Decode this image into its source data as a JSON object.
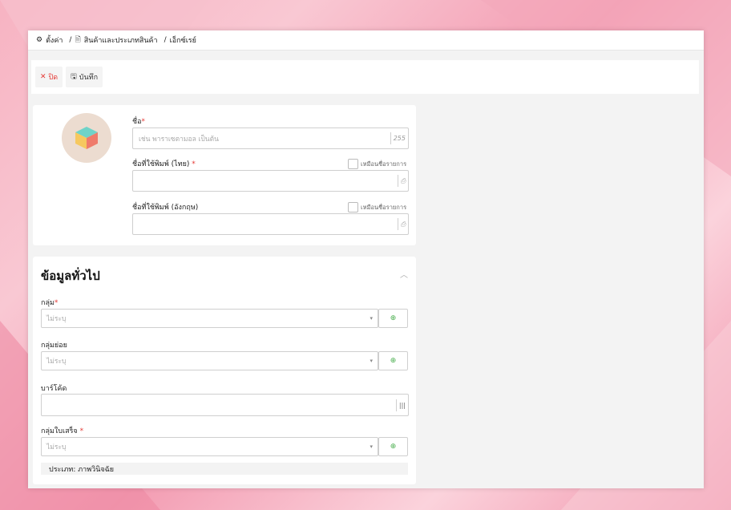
{
  "breadcrumb": {
    "settings": "ตั้งค่า",
    "products": "สินค้าและประเภทสินค้า",
    "current": "เอ็กซ์เรย์"
  },
  "toolbar": {
    "close_label": "ปิด",
    "save_label": "บันทึก"
  },
  "form": {
    "name_label": "ชื่อ",
    "name_placeholder": "เช่น พาราเซตามอล เป็นต้น",
    "name_maxlen": "255",
    "print_name_th_label": "ชื่อที่ใช้พิมพ์ (ไทย)",
    "print_name_en_label": "ชื่อที่ใช้พิมพ์ (อังกฤษ)",
    "same_as_item_label": "เหมือนชื่อรายการ"
  },
  "general": {
    "title": "ข้อมูลทั่วไป",
    "group_label": "กลุ่ม",
    "group_value": "ไม่ระบุ",
    "subgroup_label": "กลุ่มย่อย",
    "subgroup_value": "ไม่ระบุ",
    "barcode_label": "บาร์โค้ด",
    "receipt_group_label": "กลุ่มใบเสร็จ",
    "receipt_group_value": "ไม่ระบุ",
    "type_text": "ประเภท: ภาพวินิจฉัย"
  },
  "colors": {
    "accent_red": "#e53935",
    "add_green": "#4caf50"
  }
}
